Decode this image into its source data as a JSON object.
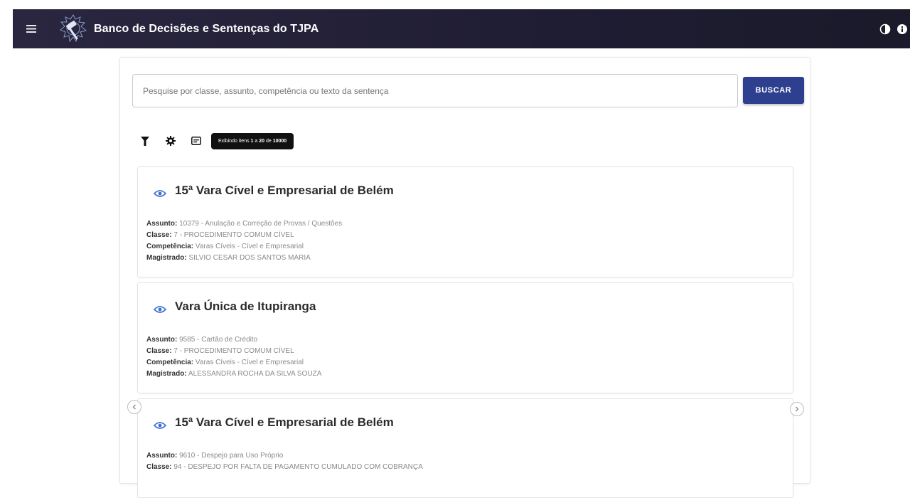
{
  "app": {
    "title": "Banco de Decisões e Sentenças do TJPA"
  },
  "header": {
    "icons": [
      "menu-icon",
      "scales-logo-icon",
      "contrast-icon",
      "info-icon"
    ]
  },
  "search": {
    "placeholder": "Pesquise por classe, assunto, competência ou texto da sentença",
    "button_label": "BUSCAR"
  },
  "toolbar": {
    "icons": [
      "filter-icon",
      "settings-icon",
      "list-view-icon"
    ],
    "results_prefix": "Exibindo itens ",
    "results_from": "1",
    "results_mid": " a ",
    "results_to": "20",
    "results_of": " de ",
    "results_total": "10000"
  },
  "labels": {
    "assunto": "Assunto:",
    "classe": "Classe:",
    "competencia": "Competência:",
    "magistrado": "Magistrado:"
  },
  "results": [
    {
      "title": "15ª Vara Cível e Empresarial de Belém",
      "assunto": " 10379 - Anulação e Correção de Provas / Questões",
      "classe": " 7 - PROCEDIMENTO COMUM CÍVEL",
      "competencia": " Varas Cíveis - Cível e Empresarial",
      "magistrado": " SILVIO CESAR DOS SANTOS MARIA"
    },
    {
      "title": "Vara Única de Itupiranga",
      "assunto": " 9585 - Cartão de Crédito",
      "classe": " 7 - PROCEDIMENTO COMUM CÍVEL",
      "competencia": " Varas Cíveis - Cível e Empresarial",
      "magistrado": " ALESSANDRA ROCHA DA SILVA SOUZA"
    },
    {
      "title": "15ª Vara Cível e Empresarial de Belém",
      "assunto": " 9610 - Despejo para Uso Próprio",
      "classe": " 94 - DESPEJO POR FALTA DE PAGAMENTO CUMULADO COM COBRANÇA"
    }
  ],
  "colors": {
    "header_bg": "#24213a",
    "primary_button": "#2f3f8f",
    "eye_icon": "#3f6fd1",
    "badge_bg": "#111111"
  }
}
